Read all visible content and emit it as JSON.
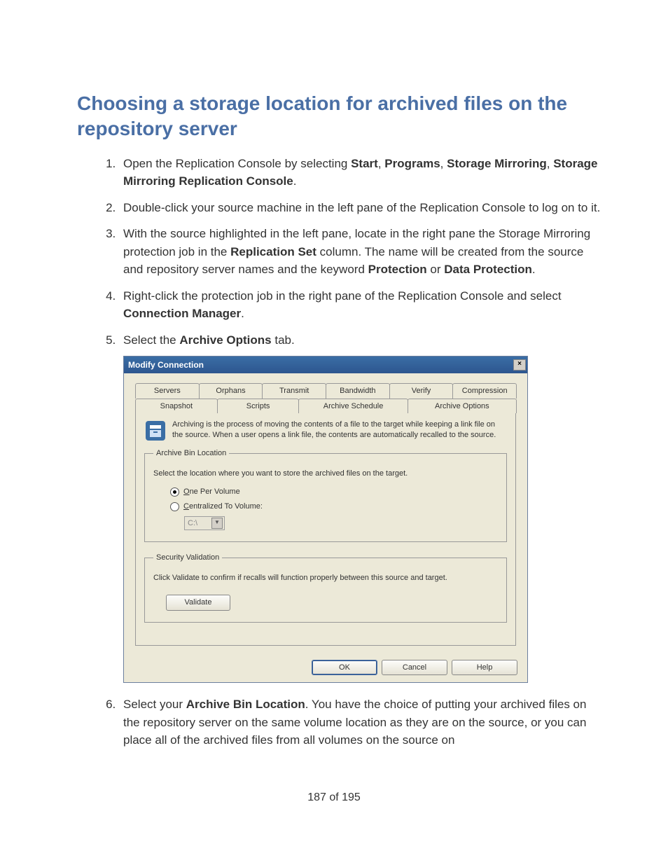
{
  "heading": "Choosing a storage location for archived files on the repository server",
  "steps": {
    "s1_a": "Open the Replication Console by selecting ",
    "s1_b1": "Start",
    "s1_b2": "Programs",
    "s1_b3": "Storage Mirroring",
    "s1_b4": "Storage Mirroring Replication Console",
    "s2": "Double-click your source machine in the left pane of the Replication Console to log on to it.",
    "s3_a": "With the source highlighted in the left pane, locate in the right pane the Storage Mirroring protection job in the ",
    "s3_b1": "Replication Set",
    "s3_c": " column. The name will be created from the source and repository server names and the keyword ",
    "s3_b2": "Protection",
    "s3_d": " or ",
    "s3_b3": "Data Protection",
    "s4_a": "Right-click the protection job in the right pane of the Replication Console and select ",
    "s4_b1": "Connection Manager",
    "s5_a": "Select the ",
    "s5_b1": "Archive Options",
    "s5_c": " tab.",
    "s6_a": "Select your ",
    "s6_b1": "Archive Bin Location",
    "s6_c": ". You have the choice of putting your archived files on the repository server on the same volume location as they are on the source, or you can place all of the archived files from all volumes on the source on"
  },
  "dialog": {
    "title": "Modify Connection",
    "tabs_top": [
      "Servers",
      "Orphans",
      "Transmit",
      "Bandwidth",
      "Verify",
      "Compression"
    ],
    "tabs_bottom": [
      "Snapshot",
      "Scripts",
      "Archive Schedule",
      "Archive Options"
    ],
    "intro": "Archiving is the process of moving the contents of a file to the target while keeping a link file on the source. When a user opens a link file, the contents are automatically recalled to the source.",
    "group1": {
      "legend": "Archive Bin Location",
      "label": "Select the location where you want to store the archived files on the target.",
      "radio1_pre": "O",
      "radio1": "ne Per Volume",
      "radio2_pre": "C",
      "radio2": "entralized To Volume:",
      "volume": "C:\\"
    },
    "group2": {
      "legend": "Security Validation",
      "label": "Click Validate to confirm if recalls will function properly between this source and target.",
      "button": "Validate"
    },
    "buttons": {
      "ok": "OK",
      "cancel": "Cancel",
      "help": "Help"
    }
  },
  "page_number": "187 of 195"
}
